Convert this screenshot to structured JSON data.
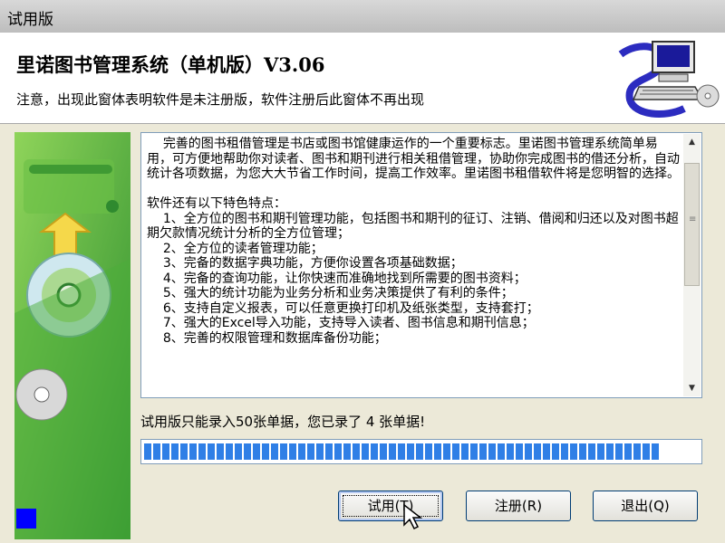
{
  "window": {
    "title": "试用版"
  },
  "header": {
    "app_title": "里诺图书管理系统（单机版）V3.06",
    "notice": "注意，出现此窗体表明软件是未注册版，软件注册后此窗体不再出现"
  },
  "description": {
    "text": "    完善的图书租借管理是书店或图书馆健康运作的一个重要标志。里诺图书管理系统简单易用，可方便地帮助你对读者、图书和期刊进行相关租借管理，协助你完成图书的借还分析，自动统计各项数据，为您大大节省工作时间，提高工作效率。里诺图书租借软件将是您明智的选择。\n\n软件还有以下特色特点：\n    1、全方位的图书和期刊管理功能，包括图书和期刊的征订、注销、借阅和归还以及对图书超期欠款情况统计分析的全方位管理；\n    2、全方位的读者管理功能；\n    3、完备的数据字典功能，方便你设置各项基础数据；\n    4、完备的查询功能，让你快速而准确地找到所需要的图书资料；\n    5、强大的统计功能为业务分析和业务决策提供了有利的条件；\n    6、支持自定义报表，可以任意更换打印机及纸张类型，支持套打；\n    7、强大的Excel导入功能，支持导入读者、图书信息和期刊信息；\n    8、完善的权限管理和数据库备份功能；"
  },
  "status": {
    "text": "试用版只能录入50张单据，您已录了 4 张单据!"
  },
  "progress": {
    "fraction": 1.0
  },
  "buttons": {
    "trial": "试用(T)",
    "register": "注册(R)",
    "exit": "退出(Q)"
  },
  "colors": {
    "progress": "#2f7fe6",
    "indicator": "#0000ff",
    "art_green": "#3aa33a"
  },
  "icons": {
    "logo": "computer-cd-logo",
    "cursor": "mouse-pointer-icon"
  }
}
